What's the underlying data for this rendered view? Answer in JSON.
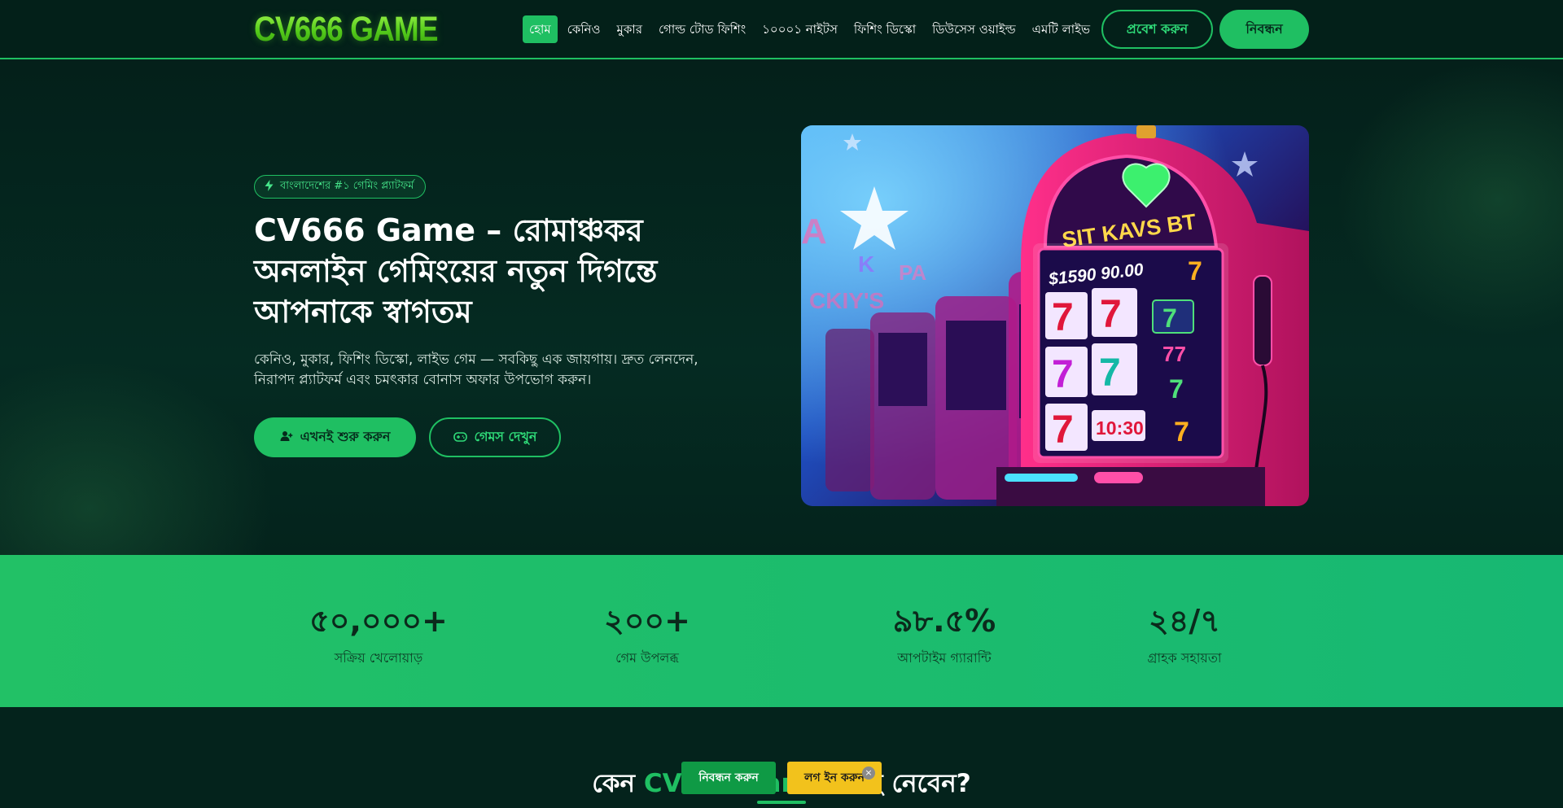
{
  "header": {
    "logo": "CV666 GAME",
    "nav": [
      "হোম",
      "কেনিও",
      "মুকার",
      "গোল্ড টোড ফিশিং",
      "১০০০১ নাইটস",
      "ফিশিং ডিস্কো",
      "ডিউসেস ওয়াইল্ড",
      "এমটি লাইভ"
    ],
    "login_label": "প্রবেশ করুন",
    "register_label": "নিবন্ধন"
  },
  "hero": {
    "badge": "বাংলাদেশের #১ গেমিং প্ল্যাটফর্ম",
    "title": "CV666 Game – রোমাঞ্চকর অনলাইন গেমিংয়ের নতুন দিগন্তে আপনাকে স্বাগতম",
    "subtitle": "কেনিও, মুকার, ফিশিং ডিস্কো, লাইভ গেম — সবকিছু এক জায়গায়। দ্রুত লেনদেন, নিরাপদ প্ল্যাটফর্ম এবং চমৎকার বোনাস অফার উপভোগ করুন।",
    "start_label": "এখনই শুরু করুন",
    "games_label": "গেমস দেখুন",
    "machine_sign": "SIT KAVS BT",
    "machine_readout": "$1590 90.00",
    "machine_time": "10:30"
  },
  "stats": [
    {
      "value": "৫০,০০০+",
      "label": "সক্রিয় খেলোয়াড়"
    },
    {
      "value": "২০০+",
      "label": "গেম উপলব্ধ"
    },
    {
      "value": "৯৮.৫%",
      "label": "আপটাইম গ্যারান্টি"
    },
    {
      "value": "২৪/৭",
      "label": "গ্রাহক সহায়তা"
    }
  ],
  "why": {
    "prefix": "কেন ",
    "accent": "CV666 Game",
    "suffix": " বেছে নেবেন?"
  },
  "floating": {
    "register_label": "নিবন্ধন করুন",
    "login_label": "লগ ইন করুন",
    "close_icon": "×"
  },
  "colors": {
    "accent": "#1fbf62",
    "background": "#04211b",
    "highlight_yellow": "#f2c21c"
  },
  "icons": {
    "badge": "bolt-icon",
    "start": "user-plus-icon",
    "games": "gamepad-icon"
  }
}
